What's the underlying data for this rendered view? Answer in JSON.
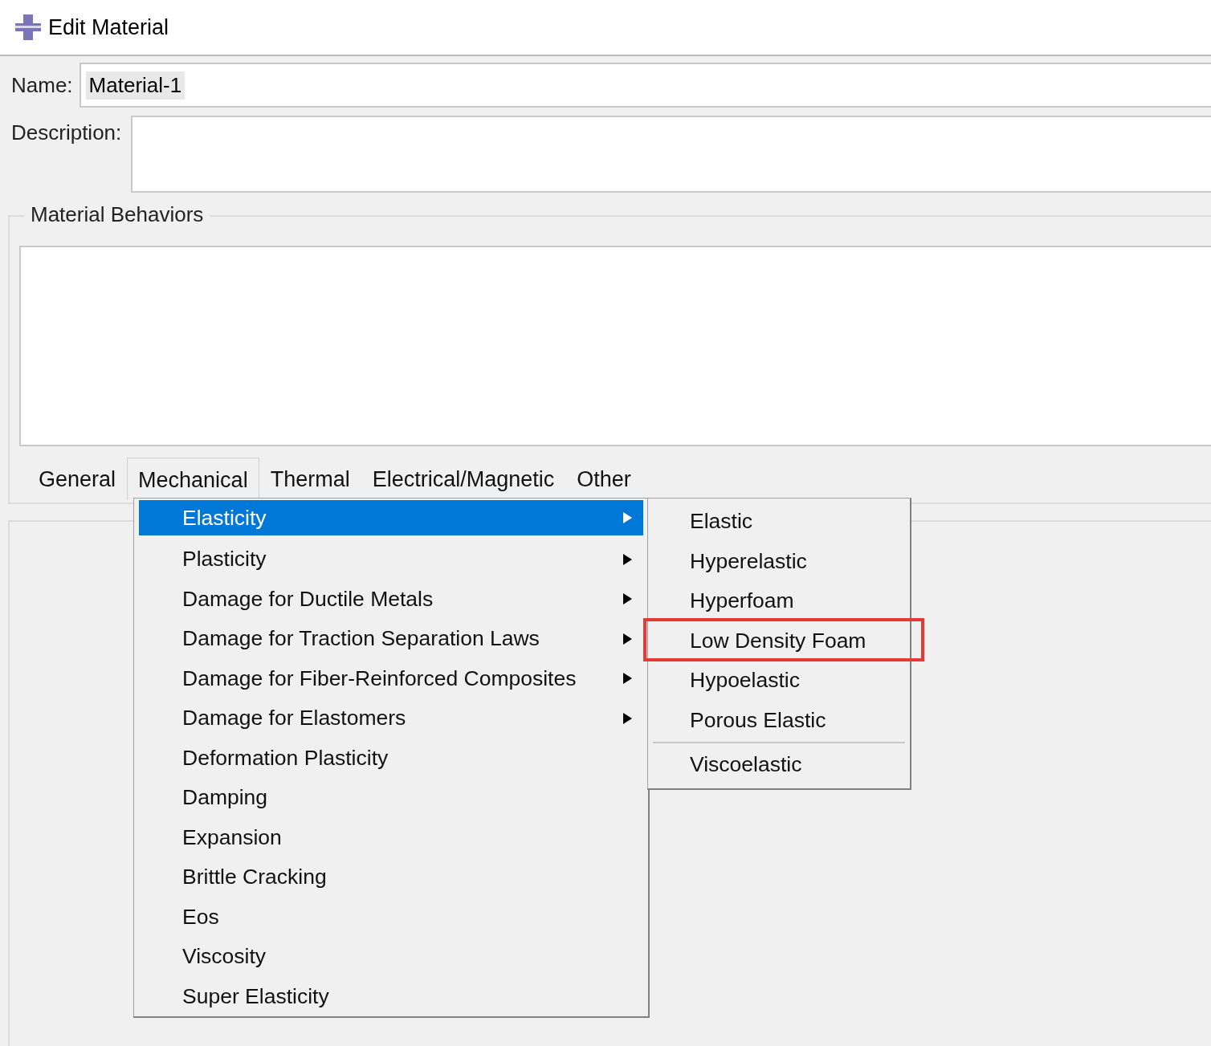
{
  "window": {
    "title": "Edit Material"
  },
  "name_field": {
    "label": "Name:",
    "value": "Material-1"
  },
  "description_field": {
    "label": "Description:"
  },
  "behaviors_group": {
    "title": "Material Behaviors"
  },
  "menu_tabs": [
    {
      "label": "General",
      "selected": false
    },
    {
      "label": "Mechanical",
      "selected": true
    },
    {
      "label": "Thermal",
      "selected": false
    },
    {
      "label": "Electrical/Magnetic",
      "selected": false
    },
    {
      "label": "Other",
      "selected": false
    }
  ],
  "dropdown_menu": {
    "items": [
      {
        "label": "Elasticity",
        "has_submenu": true,
        "selected": true
      },
      {
        "label": "Plasticity",
        "has_submenu": true,
        "selected": false
      },
      {
        "label": "Damage for Ductile Metals",
        "has_submenu": true,
        "selected": false
      },
      {
        "label": "Damage for Traction Separation Laws",
        "has_submenu": true,
        "selected": false
      },
      {
        "label": "Damage for Fiber-Reinforced Composites",
        "has_submenu": true,
        "selected": false
      },
      {
        "label": "Damage for Elastomers",
        "has_submenu": true,
        "selected": false
      },
      {
        "label": "Deformation Plasticity",
        "has_submenu": false,
        "selected": false
      },
      {
        "label": "Damping",
        "has_submenu": false,
        "selected": false
      },
      {
        "label": "Expansion",
        "has_submenu": false,
        "selected": false
      },
      {
        "label": "Brittle Cracking",
        "has_submenu": false,
        "selected": false
      },
      {
        "label": "Eos",
        "has_submenu": false,
        "selected": false
      },
      {
        "label": "Viscosity",
        "has_submenu": false,
        "selected": false
      },
      {
        "label": "Super Elasticity",
        "has_submenu": false,
        "selected": false
      }
    ]
  },
  "submenu": {
    "items": [
      {
        "label": "Elastic",
        "separator_before": false,
        "highlighted": false
      },
      {
        "label": "Hyperelastic",
        "separator_before": false,
        "highlighted": false
      },
      {
        "label": "Hyperfoam",
        "separator_before": false,
        "highlighted": false
      },
      {
        "label": "Low Density Foam",
        "separator_before": false,
        "highlighted": true
      },
      {
        "label": "Hypoelastic",
        "separator_before": false,
        "highlighted": false
      },
      {
        "label": "Porous Elastic",
        "separator_before": false,
        "highlighted": false
      },
      {
        "label": "Viscoelastic",
        "separator_before": true,
        "highlighted": false
      }
    ]
  }
}
